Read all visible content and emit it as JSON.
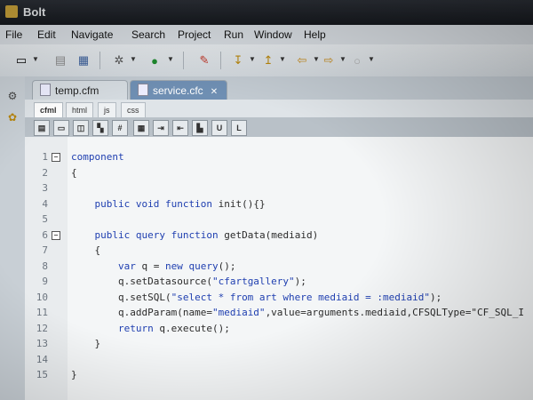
{
  "window": {
    "title": "Bolt"
  },
  "menu": [
    "File",
    "Edit",
    "Navigate",
    "Search",
    "Project",
    "Run",
    "Window",
    "Help"
  ],
  "tabs": [
    {
      "label": "temp.cfm",
      "active": false
    },
    {
      "label": "service.cfc",
      "active": true
    }
  ],
  "lang_tabs": [
    "cfml",
    "html",
    "js",
    "css"
  ],
  "editor_toolbar_letters": [
    "U",
    "L"
  ],
  "code": [
    {
      "num": "1",
      "fold": true,
      "text": "component"
    },
    {
      "num": "2",
      "fold": false,
      "text": "{"
    },
    {
      "num": "3",
      "fold": false,
      "text": ""
    },
    {
      "num": "4",
      "fold": false,
      "text": "    public void function init(){}"
    },
    {
      "num": "5",
      "fold": false,
      "text": ""
    },
    {
      "num": "6",
      "fold": true,
      "text": "    public query function getData(mediaid)"
    },
    {
      "num": "7",
      "fold": false,
      "text": "    {"
    },
    {
      "num": "8",
      "fold": false,
      "text": "        var q = new query();"
    },
    {
      "num": "9",
      "fold": false,
      "text": "        q.setDatasource(\"cfartgallery\");"
    },
    {
      "num": "10",
      "fold": false,
      "text": "        q.setSQL(\"select * from art where mediaid = :mediaid\");"
    },
    {
      "num": "11",
      "fold": false,
      "text": "        q.addParam(name=\"mediaid\",value=arguments.mediaid,CFSQLType=\"CF_SQL_I"
    },
    {
      "num": "12",
      "fold": false,
      "text": "        return q.execute();"
    },
    {
      "num": "13",
      "fold": false,
      "text": "    }"
    },
    {
      "num": "14",
      "fold": false,
      "text": ""
    },
    {
      "num": "15",
      "fold": false,
      "text": "}"
    }
  ],
  "colors": {
    "keyword": "#1f3fb0",
    "active_tab": "#6f8fb3",
    "titlebar": "#15181d"
  }
}
